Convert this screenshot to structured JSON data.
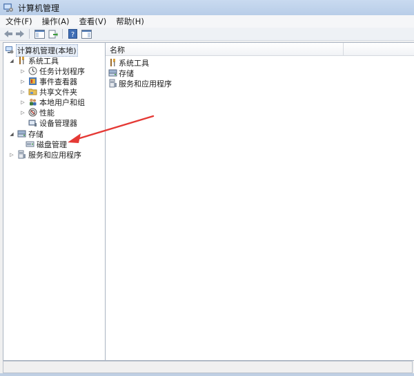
{
  "window": {
    "title": "计算机管理"
  },
  "menu": [
    {
      "label": "文件(F)"
    },
    {
      "label": "操作(A)"
    },
    {
      "label": "查看(V)"
    },
    {
      "label": "帮助(H)"
    }
  ],
  "tree": {
    "root": "计算机管理(本地)",
    "system_tools": "系统工具",
    "task_scheduler": "任务计划程序",
    "event_viewer": "事件查看器",
    "shared_folders": "共享文件夹",
    "local_users_groups": "本地用户和组",
    "performance": "性能",
    "device_manager": "设备管理器",
    "storage": "存储",
    "disk_management": "磁盘管理",
    "services_apps": "服务和应用程序"
  },
  "list": {
    "column_name": "名称",
    "items": [
      {
        "label": "系统工具"
      },
      {
        "label": "存储"
      },
      {
        "label": "服务和应用程序"
      }
    ]
  },
  "annotation": {
    "arrow_color": "#e53935"
  }
}
